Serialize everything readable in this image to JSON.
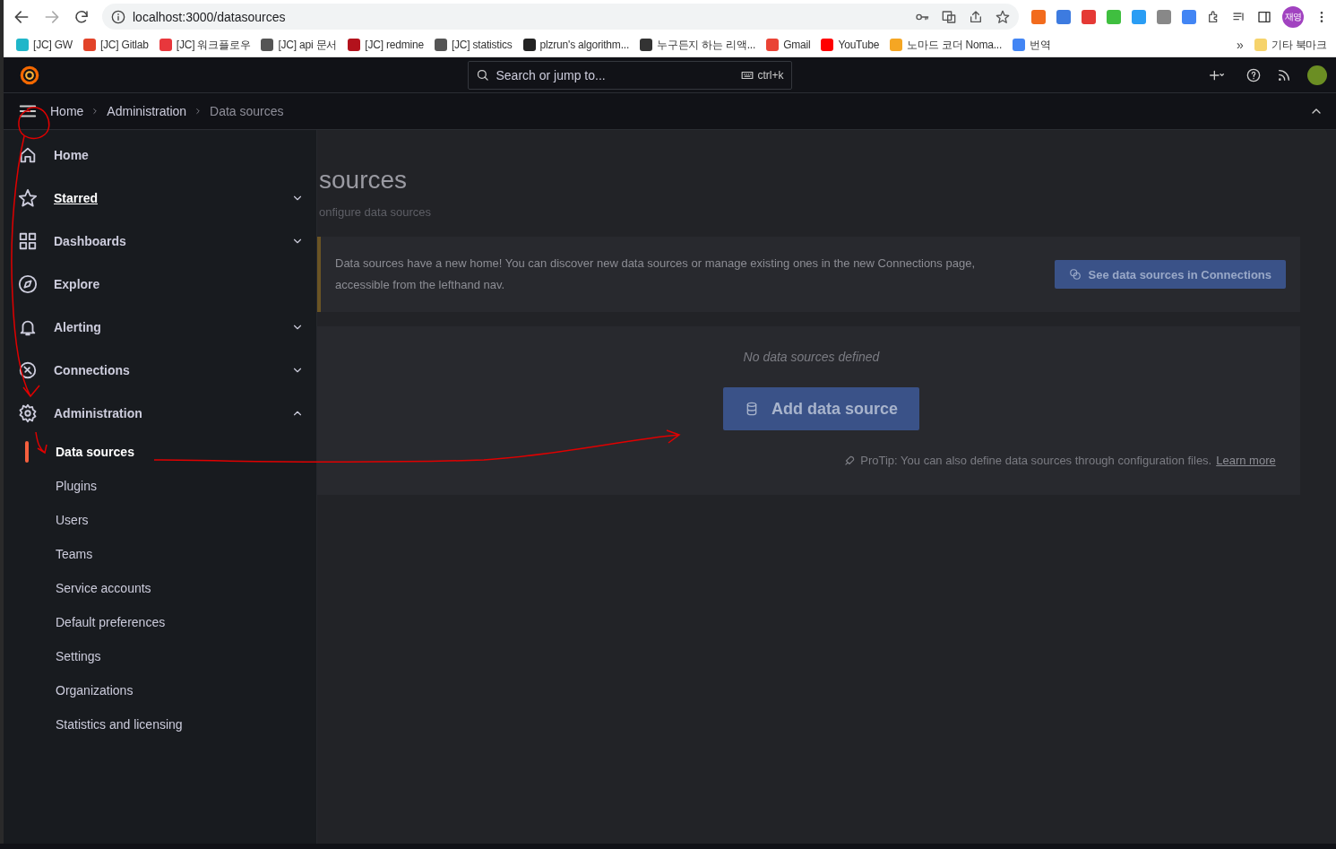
{
  "browser": {
    "url": "localhost:3000/datasources",
    "profile": "재영",
    "bookmarks": [
      {
        "label": "[JC] GW",
        "color": "#1fb6c9"
      },
      {
        "label": "[JC] Gitlab",
        "color": "#e24329"
      },
      {
        "label": "[JC] 워크플로우",
        "color": "#e8373c"
      },
      {
        "label": "[JC] api 문서",
        "color": "#555555"
      },
      {
        "label": "[JC] redmine",
        "color": "#b3121c"
      },
      {
        "label": "[JC] statistics",
        "color": "#555555"
      },
      {
        "label": "plzrun's algorithm...",
        "color": "#222222"
      },
      {
        "label": "누구든지 하는 리액...",
        "color": "#333333"
      },
      {
        "label": "Gmail",
        "color": "#ea4335"
      },
      {
        "label": "YouTube",
        "color": "#ff0000"
      },
      {
        "label": "노마드 코더 Noma...",
        "color": "#f5a623"
      },
      {
        "label": "번역",
        "color": "#4285f4"
      }
    ],
    "more": "»",
    "other_bookmarks": "기타 북마크"
  },
  "topbar": {
    "search_placeholder": "Search or jump to...",
    "shortcut": "ctrl+k"
  },
  "breadcrumbs": [
    {
      "label": "Home",
      "current": false
    },
    {
      "label": "Administration",
      "current": false
    },
    {
      "label": "Data sources",
      "current": true
    }
  ],
  "nav": [
    {
      "label": "Home",
      "hovered": false
    },
    {
      "label": "Starred",
      "hovered": true,
      "expanded": false
    },
    {
      "label": "Dashboards",
      "hovered": false,
      "expanded": false
    },
    {
      "label": "Explore",
      "hovered": false
    },
    {
      "label": "Alerting",
      "hovered": false,
      "expanded": false
    },
    {
      "label": "Connections",
      "hovered": false,
      "expanded": false
    },
    {
      "label": "Administration",
      "hovered": false,
      "expanded": true,
      "children": [
        {
          "label": "Data sources",
          "selected": true
        },
        {
          "label": "Plugins",
          "selected": false
        },
        {
          "label": "Users",
          "selected": false
        },
        {
          "label": "Teams",
          "selected": false
        },
        {
          "label": "Service accounts",
          "selected": false
        },
        {
          "label": "Default preferences",
          "selected": false
        },
        {
          "label": "Settings",
          "selected": false
        },
        {
          "label": "Organizations",
          "selected": false
        },
        {
          "label": "Statistics and licensing",
          "selected": false
        }
      ]
    }
  ],
  "page": {
    "title": "sources",
    "subtitle": "onfigure data sources",
    "alert": {
      "text": "Data sources have a new home! You can discover new data sources or manage existing ones in the new Connections page, accessible from the lefthand nav.",
      "button": "See data sources in Connections"
    },
    "empty": {
      "message": "No data sources defined",
      "button": "Add data source",
      "tip": "ProTip: You can also define data sources through configuration files.",
      "tip_link": "Learn more"
    }
  }
}
